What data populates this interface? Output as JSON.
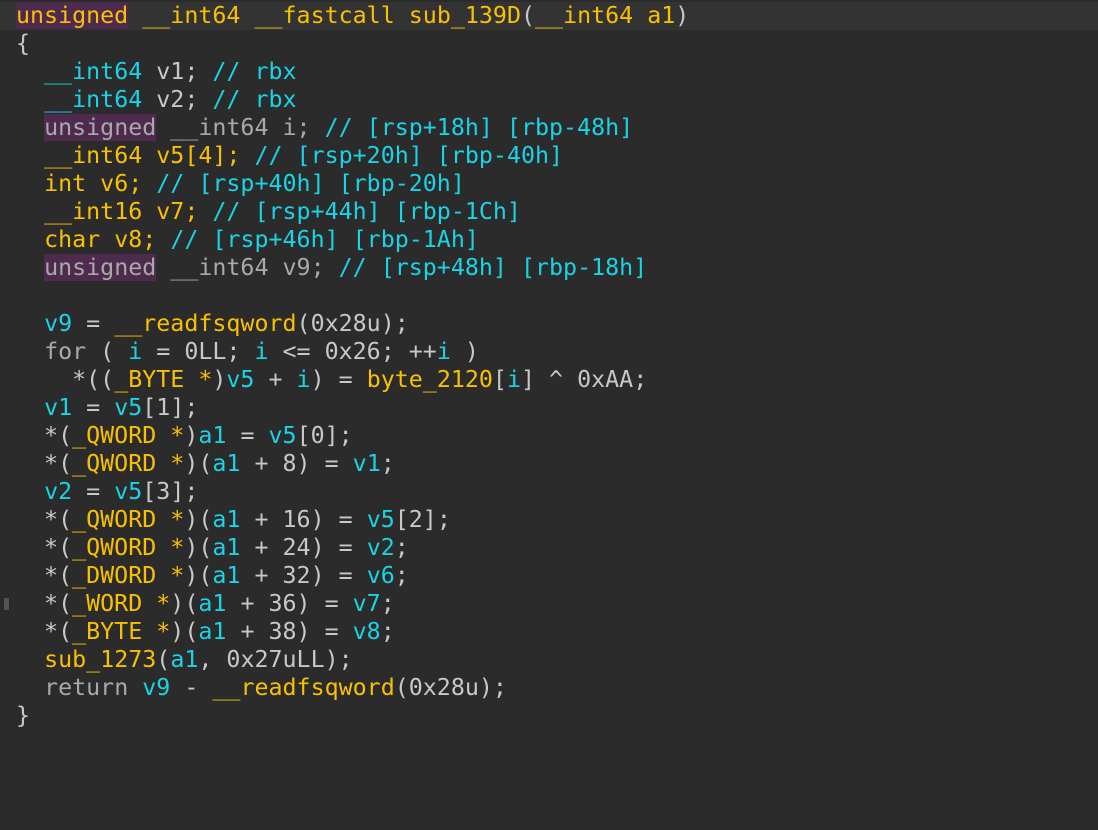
{
  "editor": {
    "lines": [
      {
        "id": "L1",
        "tokens": [
          {
            "t": "unsigned",
            "c": "kwmy"
          },
          {
            "t": " ",
            "c": "p"
          },
          {
            "t": "__int64",
            "c": "y"
          },
          {
            "t": " ",
            "c": "p"
          },
          {
            "t": "__fastcall",
            "c": "y"
          },
          {
            "t": " ",
            "c": "p"
          },
          {
            "t": "sub_139D",
            "c": "y"
          },
          {
            "t": "(",
            "c": "p"
          },
          {
            "t": "__int64",
            "c": "y"
          },
          {
            "t": " a1",
            "c": "y"
          },
          {
            "t": ")",
            "c": "p"
          }
        ]
      },
      {
        "id": "L2",
        "tokens": [
          {
            "t": "{",
            "c": "p"
          }
        ]
      },
      {
        "id": "L3",
        "tokens": [
          {
            "t": "  ",
            "c": "p"
          },
          {
            "t": "__int64",
            "c": "c"
          },
          {
            "t": " v1; ",
            "c": "p"
          },
          {
            "t": "// rbx",
            "c": "c"
          }
        ]
      },
      {
        "id": "L4",
        "tokens": [
          {
            "t": "  ",
            "c": "p"
          },
          {
            "t": "__int64",
            "c": "c"
          },
          {
            "t": " v2; ",
            "c": "p"
          },
          {
            "t": "// rbx",
            "c": "c"
          }
        ]
      },
      {
        "id": "L5",
        "tokens": [
          {
            "t": "  ",
            "c": "p"
          },
          {
            "t": "unsigned",
            "c": "kwm"
          },
          {
            "t": " __int64 i; ",
            "c": "n"
          },
          {
            "t": "// [rsp+18h] [rbp-48h]",
            "c": "c"
          }
        ]
      },
      {
        "id": "L6",
        "tokens": [
          {
            "t": "  ",
            "c": "p"
          },
          {
            "t": "__int64",
            "c": "y"
          },
          {
            "t": " v5[4]; ",
            "c": "y"
          },
          {
            "t": "// [rsp+20h] [rbp-40h]",
            "c": "c"
          }
        ]
      },
      {
        "id": "L7",
        "tokens": [
          {
            "t": "  ",
            "c": "p"
          },
          {
            "t": "int",
            "c": "y"
          },
          {
            "t": " v6; ",
            "c": "y"
          },
          {
            "t": "// [rsp+40h] [rbp-20h]",
            "c": "c"
          }
        ]
      },
      {
        "id": "L8",
        "tokens": [
          {
            "t": "  ",
            "c": "p"
          },
          {
            "t": "__int16",
            "c": "y"
          },
          {
            "t": " v7; ",
            "c": "y"
          },
          {
            "t": "// [rsp+44h] [rbp-1Ch]",
            "c": "c"
          }
        ]
      },
      {
        "id": "L9",
        "tokens": [
          {
            "t": "  ",
            "c": "p"
          },
          {
            "t": "char",
            "c": "y"
          },
          {
            "t": " v8; ",
            "c": "y"
          },
          {
            "t": "// [rsp+46h] [rbp-1Ah]",
            "c": "c"
          }
        ]
      },
      {
        "id": "L10",
        "tokens": [
          {
            "t": "  ",
            "c": "p"
          },
          {
            "t": "unsigned",
            "c": "kwm"
          },
          {
            "t": " __int64 v9; ",
            "c": "n"
          },
          {
            "t": "// [rsp+48h] [rbp-18h]",
            "c": "c"
          }
        ]
      },
      {
        "id": "L11",
        "tokens": [
          {
            "t": "",
            "c": "p"
          }
        ]
      },
      {
        "id": "L12",
        "tokens": [
          {
            "t": "  ",
            "c": "p"
          },
          {
            "t": "v9",
            "c": "v"
          },
          {
            "t": " = ",
            "c": "p"
          },
          {
            "t": "__readfsqword",
            "c": "y"
          },
          {
            "t": "(0x28u);",
            "c": "p"
          }
        ]
      },
      {
        "id": "L13",
        "tokens": [
          {
            "t": "  ",
            "c": "p"
          },
          {
            "t": "for",
            "c": "kw"
          },
          {
            "t": " ( ",
            "c": "p"
          },
          {
            "t": "i",
            "c": "v"
          },
          {
            "t": " = 0LL; ",
            "c": "p"
          },
          {
            "t": "i",
            "c": "v"
          },
          {
            "t": " <= 0x26; ++",
            "c": "p"
          },
          {
            "t": "i",
            "c": "v"
          },
          {
            "t": " )",
            "c": "p"
          }
        ]
      },
      {
        "id": "L14",
        "tokens": [
          {
            "t": "    *((",
            "c": "p"
          },
          {
            "t": "_BYTE *",
            "c": "y"
          },
          {
            "t": ")",
            "c": "p"
          },
          {
            "t": "v5",
            "c": "v"
          },
          {
            "t": " + ",
            "c": "p"
          },
          {
            "t": "i",
            "c": "v"
          },
          {
            "t": ") = ",
            "c": "p"
          },
          {
            "t": "byte_2120",
            "c": "y"
          },
          {
            "t": "[",
            "c": "p"
          },
          {
            "t": "i",
            "c": "v"
          },
          {
            "t": "] ^ 0xAA;",
            "c": "p"
          }
        ]
      },
      {
        "id": "L15",
        "tokens": [
          {
            "t": "  ",
            "c": "p"
          },
          {
            "t": "v1",
            "c": "v"
          },
          {
            "t": " = ",
            "c": "p"
          },
          {
            "t": "v5",
            "c": "v"
          },
          {
            "t": "[1];",
            "c": "p"
          }
        ]
      },
      {
        "id": "L16",
        "tokens": [
          {
            "t": "  *(",
            "c": "p"
          },
          {
            "t": "_QWORD *",
            "c": "y"
          },
          {
            "t": ")",
            "c": "p"
          },
          {
            "t": "a1",
            "c": "v"
          },
          {
            "t": " = ",
            "c": "p"
          },
          {
            "t": "v5",
            "c": "v"
          },
          {
            "t": "[0];",
            "c": "p"
          }
        ]
      },
      {
        "id": "L17",
        "tokens": [
          {
            "t": "  *(",
            "c": "p"
          },
          {
            "t": "_QWORD *",
            "c": "y"
          },
          {
            "t": ")(",
            "c": "p"
          },
          {
            "t": "a1",
            "c": "v"
          },
          {
            "t": " + 8) = ",
            "c": "p"
          },
          {
            "t": "v1",
            "c": "v"
          },
          {
            "t": ";",
            "c": "p"
          }
        ]
      },
      {
        "id": "L18",
        "tokens": [
          {
            "t": "  ",
            "c": "p"
          },
          {
            "t": "v2",
            "c": "v"
          },
          {
            "t": " = ",
            "c": "p"
          },
          {
            "t": "v5",
            "c": "v"
          },
          {
            "t": "[3];",
            "c": "p"
          }
        ]
      },
      {
        "id": "L19",
        "tokens": [
          {
            "t": "  *(",
            "c": "p"
          },
          {
            "t": "_QWORD *",
            "c": "y"
          },
          {
            "t": ")(",
            "c": "p"
          },
          {
            "t": "a1",
            "c": "v"
          },
          {
            "t": " + 16) = ",
            "c": "p"
          },
          {
            "t": "v5",
            "c": "v"
          },
          {
            "t": "[2];",
            "c": "p"
          }
        ]
      },
      {
        "id": "L20",
        "tokens": [
          {
            "t": "  *(",
            "c": "p"
          },
          {
            "t": "_QWORD *",
            "c": "y"
          },
          {
            "t": ")(",
            "c": "p"
          },
          {
            "t": "a1",
            "c": "v"
          },
          {
            "t": " + 24) = ",
            "c": "p"
          },
          {
            "t": "v2",
            "c": "v"
          },
          {
            "t": ";",
            "c": "p"
          }
        ]
      },
      {
        "id": "L21",
        "tokens": [
          {
            "t": "  *(",
            "c": "p"
          },
          {
            "t": "_DWORD *",
            "c": "y"
          },
          {
            "t": ")(",
            "c": "p"
          },
          {
            "t": "a1",
            "c": "v"
          },
          {
            "t": " + 32) = ",
            "c": "p"
          },
          {
            "t": "v6",
            "c": "v"
          },
          {
            "t": ";",
            "c": "p"
          }
        ]
      },
      {
        "id": "L22",
        "tokens": [
          {
            "t": "  *(",
            "c": "p"
          },
          {
            "t": "_WORD *",
            "c": "y"
          },
          {
            "t": ")(",
            "c": "p"
          },
          {
            "t": "a1",
            "c": "v"
          },
          {
            "t": " + 36) = ",
            "c": "p"
          },
          {
            "t": "v7",
            "c": "v"
          },
          {
            "t": ";",
            "c": "p"
          }
        ]
      },
      {
        "id": "L23",
        "tokens": [
          {
            "t": "  *(",
            "c": "p"
          },
          {
            "t": "_BYTE *",
            "c": "y"
          },
          {
            "t": ")(",
            "c": "p"
          },
          {
            "t": "a1",
            "c": "v"
          },
          {
            "t": " + 38) = ",
            "c": "p"
          },
          {
            "t": "v8",
            "c": "v"
          },
          {
            "t": ";",
            "c": "p"
          }
        ]
      },
      {
        "id": "L24",
        "tokens": [
          {
            "t": "  ",
            "c": "p"
          },
          {
            "t": "sub_1273",
            "c": "y"
          },
          {
            "t": "(",
            "c": "p"
          },
          {
            "t": "a1",
            "c": "v"
          },
          {
            "t": ", 0x27uLL);",
            "c": "p"
          }
        ]
      },
      {
        "id": "L25",
        "tokens": [
          {
            "t": "  ",
            "c": "p"
          },
          {
            "t": "return",
            "c": "kw"
          },
          {
            "t": " ",
            "c": "p"
          },
          {
            "t": "v9",
            "c": "v"
          },
          {
            "t": " - ",
            "c": "p"
          },
          {
            "t": "__readfsqword",
            "c": "y"
          },
          {
            "t": "(0x28u);",
            "c": "p"
          }
        ]
      },
      {
        "id": "L26",
        "tokens": [
          {
            "t": "}",
            "c": "p"
          }
        ]
      }
    ]
  }
}
